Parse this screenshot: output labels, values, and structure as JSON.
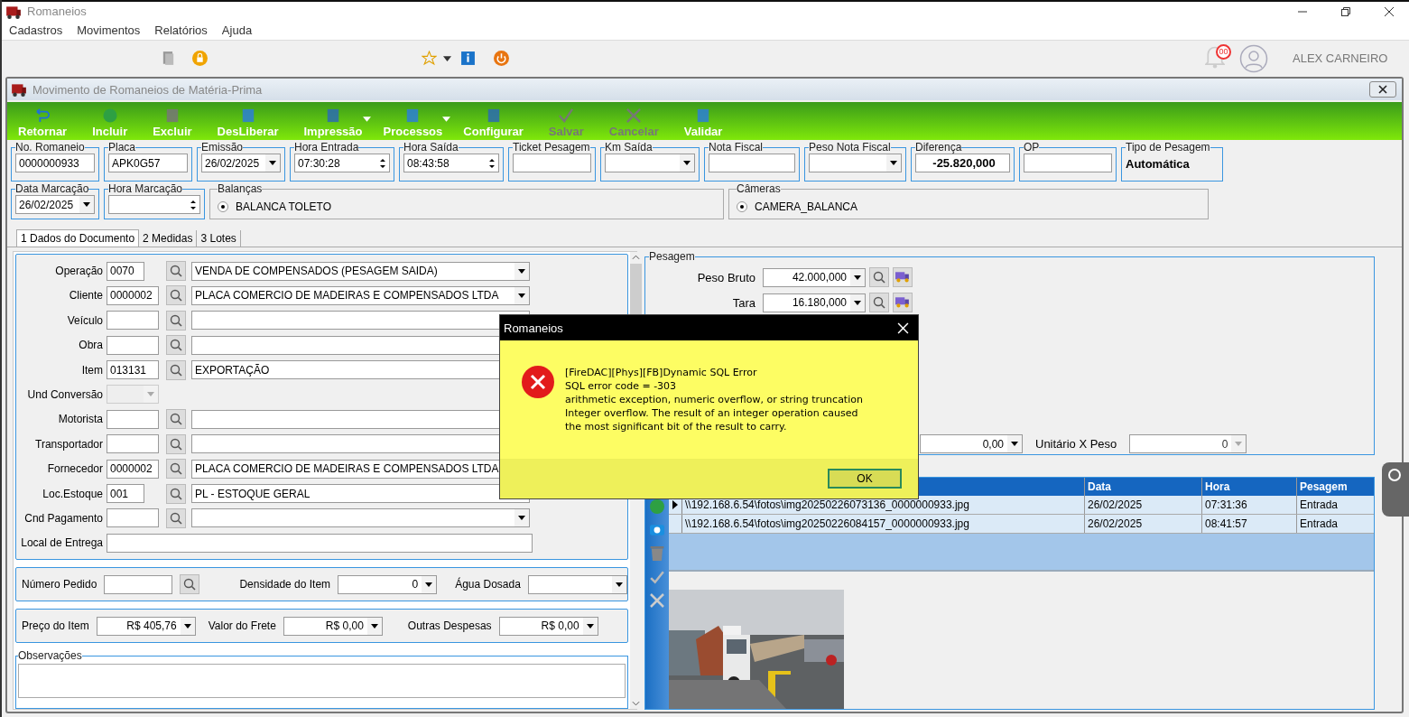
{
  "app": {
    "title": "Romaneios",
    "menu": [
      "Cadastros",
      "Movimentos",
      "Relatórios",
      "Ajuda"
    ],
    "notification_count": "00",
    "user": "ALEX CARNEIRO"
  },
  "window": {
    "title": "Movimento de Romaneios de Matéria-Prima"
  },
  "toolbar": [
    {
      "label": "Retornar",
      "disabled": false,
      "dropdown": false
    },
    {
      "label": "Incluir",
      "disabled": false,
      "dropdown": false
    },
    {
      "label": "Excluir",
      "disabled": false,
      "dropdown": false
    },
    {
      "label": "DesLiberar",
      "disabled": false,
      "dropdown": false
    },
    {
      "label": "Impressão",
      "disabled": false,
      "dropdown": true
    },
    {
      "label": "Processos",
      "disabled": false,
      "dropdown": true
    },
    {
      "label": "Configurar",
      "disabled": false,
      "dropdown": false
    },
    {
      "label": "Salvar",
      "disabled": true,
      "dropdown": false
    },
    {
      "label": "Cancelar",
      "disabled": true,
      "dropdown": false
    },
    {
      "label": "Validar",
      "disabled": false,
      "dropdown": false
    }
  ],
  "header_fields": [
    {
      "label": "No. Romaneio",
      "value": "0000000933",
      "kind": "text"
    },
    {
      "label": "Placa",
      "value": "APK0G57",
      "kind": "text"
    },
    {
      "label": "Emissão",
      "value": "26/02/2025",
      "kind": "combo"
    },
    {
      "label": "Hora Entrada",
      "value": "07:30:28",
      "kind": "spin"
    },
    {
      "label": "Hora Saída",
      "value": "08:43:58",
      "kind": "spin"
    },
    {
      "label": "Ticket Pesagem",
      "kind": "text"
    },
    {
      "label": "Km Saída",
      "kind": "combo"
    },
    {
      "label": "Nota Fiscal",
      "kind": "text"
    },
    {
      "label": "Peso Nota Fiscal",
      "kind": "combo"
    },
    {
      "label": "Diferença",
      "value": "-25.820,000",
      "kind": "bold"
    },
    {
      "label": "OP",
      "kind": "text"
    },
    {
      "label": "Tipo de Pesagem",
      "value": "Automática",
      "kind": "display"
    }
  ],
  "marking_fields": [
    {
      "label": "Data Marcação",
      "value": "26/02/2025",
      "kind": "combo"
    },
    {
      "label": "Hora Marcação",
      "kind": "spin"
    }
  ],
  "balancas": {
    "label": "Balanças",
    "options": [
      {
        "label": "BALANCA TOLETO",
        "selected": true
      }
    ]
  },
  "cameras": {
    "label": "Câmeras",
    "options": [
      {
        "label": "CAMERA_BALANCA",
        "selected": true
      }
    ]
  },
  "tabs": [
    {
      "label": "1 Dados do Documento",
      "selected": true
    },
    {
      "label": "2 Medidas",
      "selected": false
    },
    {
      "label": "3 Lotes",
      "selected": false
    }
  ],
  "document_rows": [
    {
      "label": "Operação",
      "code": "0070",
      "kind": "lookup_combo",
      "description": "VENDA DE COMPENSADOS (PESAGEM SAIDA)"
    },
    {
      "label": "Cliente",
      "code": "0000002",
      "kind": "lookup_combo",
      "description": "PLACA COMERCIO DE MADEIRAS E COMPENSADOS LTDA"
    },
    {
      "label": "Veículo",
      "kind": "lookup"
    },
    {
      "label": "Obra",
      "kind": "lookup"
    },
    {
      "label": "Item",
      "code": "013131",
      "kind": "lookup",
      "description": "EXPORTAÇÃO"
    },
    {
      "label": "Und Conversão",
      "kind": "disabled_combo"
    },
    {
      "label": "Motorista",
      "kind": "lookup"
    },
    {
      "label": "Transportador",
      "kind": "lookup"
    },
    {
      "label": "Fornecedor",
      "code": "0000002",
      "kind": "lookup",
      "description": "PLACA COMERCIO DE MADEIRAS E COMPENSADOS LTDA"
    },
    {
      "label": "Loc.Estoque",
      "code": "001",
      "kind": "lookup",
      "description": "PL - ESTOQUE GERAL"
    },
    {
      "label": "Cnd Pagamento",
      "kind": "lookup_combo"
    },
    {
      "label": "Local de Entrega",
      "kind": "wide"
    }
  ],
  "pedido_row": [
    {
      "label": "Número Pedido",
      "kind": "lookup"
    },
    {
      "label": "Densidade do Item",
      "value": "0",
      "kind": "combo"
    },
    {
      "label": "Água Dosada",
      "kind": "combo"
    }
  ],
  "price_row": [
    {
      "label": "Preço do Item",
      "value": "R$ 405,76",
      "kind": "combo"
    },
    {
      "label": "Valor do Frete",
      "value": "R$ 0,00",
      "kind": "combo"
    },
    {
      "label": "Outras Despesas",
      "value": "R$ 0,00",
      "kind": "combo"
    }
  ],
  "observacoes": {
    "label": "Observações"
  },
  "pesagem": {
    "title": "Pesagem",
    "rows": [
      {
        "label": "Peso Bruto",
        "value": "42.000,000"
      },
      {
        "label": "Tara",
        "value": "16.180,000"
      }
    ],
    "extra_value": "0,00",
    "unit_label": "Unitário X Peso",
    "unit_value": "0"
  },
  "photos": {
    "columns": [
      "Data",
      "Hora",
      "Pesagem"
    ],
    "rows": [
      {
        "selected": true,
        "column_1": "\\\\192.168.6.54\\fotos\\img20250226073136_0000000933.jpg",
        "data": "26/02/2025",
        "hora": "07:31:36",
        "pesagem": "Entrada"
      },
      {
        "selected": false,
        "column_1": "\\\\192.168.6.54\\fotos\\img20250226084157_0000000933.jpg",
        "data": "26/02/2025",
        "hora": "08:41:57",
        "pesagem": "Entrada"
      }
    ],
    "preview": {
      "kind": "picture"
    }
  },
  "dialog": {
    "title": "Romaneios",
    "lines": [
      "[FireDAC][Phys][FB]Dynamic SQL Error",
      "SQL error code = -303",
      "arithmetic exception, numeric overflow, or string truncation",
      "Integer overflow.  The result of an integer operation caused",
      "the most significant bit of the result to carry."
    ],
    "button": "OK"
  }
}
